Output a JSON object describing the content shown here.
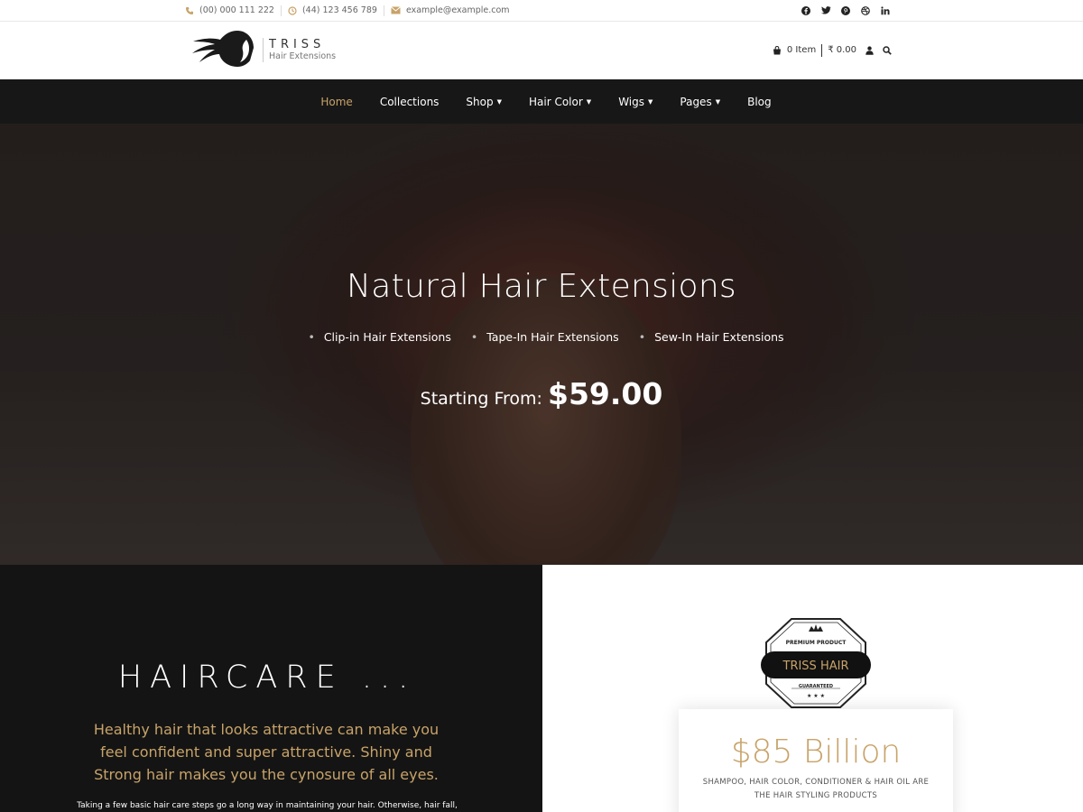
{
  "topbar": {
    "phone": "(00) 000 111 222",
    "hours": "(44) 123 456 789",
    "email": "example@example.com",
    "social": [
      "facebook-icon",
      "twitter-icon",
      "pinterest-icon",
      "dribbble-icon",
      "linkedin-icon"
    ]
  },
  "header": {
    "logo_title": "TRISS",
    "logo_subtitle": "Hair Extensions",
    "cart_items": "0 Item",
    "cart_total": "₹ 0.00"
  },
  "nav": {
    "items": [
      {
        "label": "Home",
        "active": true
      },
      {
        "label": "Collections"
      },
      {
        "label": "Shop",
        "dropdown": true
      },
      {
        "label": "Hair Color",
        "dropdown": true
      },
      {
        "label": "Wigs",
        "dropdown": true
      },
      {
        "label": "Pages",
        "dropdown": true
      },
      {
        "label": "Blog"
      }
    ]
  },
  "hero": {
    "title": "Natural Hair Extensions",
    "types": [
      "Clip-in Hair Extensions",
      "Tape-In Hair Extensions",
      "Sew-In Hair Extensions"
    ],
    "price_label": "Starting From:",
    "price_value": "$59.00"
  },
  "haircare": {
    "heading": "HAIRCARE ...",
    "tagline": "Healthy hair that looks attractive can make you feel confident and super attractive. Shiny and Strong hair makes you the cynosure of all eyes.",
    "body": "Taking a few basic hair care steps go a long way in maintaining your hair. Otherwise, hair fall,"
  },
  "badge": {
    "top": "PREMIUM PRODUCT",
    "name": "TRISS HAIR",
    "bottom": "GUARANTEED"
  },
  "stat": {
    "value": "$85 Billion",
    "description": "SHAMPOO, HAIR COLOR, CONDITIONER & HAIR OIL ARE THE HAIR STYLING PRODUCTS"
  },
  "colors": {
    "accent": "#c8a369",
    "nav_bg": "#171717",
    "dark_panel": "#141414"
  }
}
